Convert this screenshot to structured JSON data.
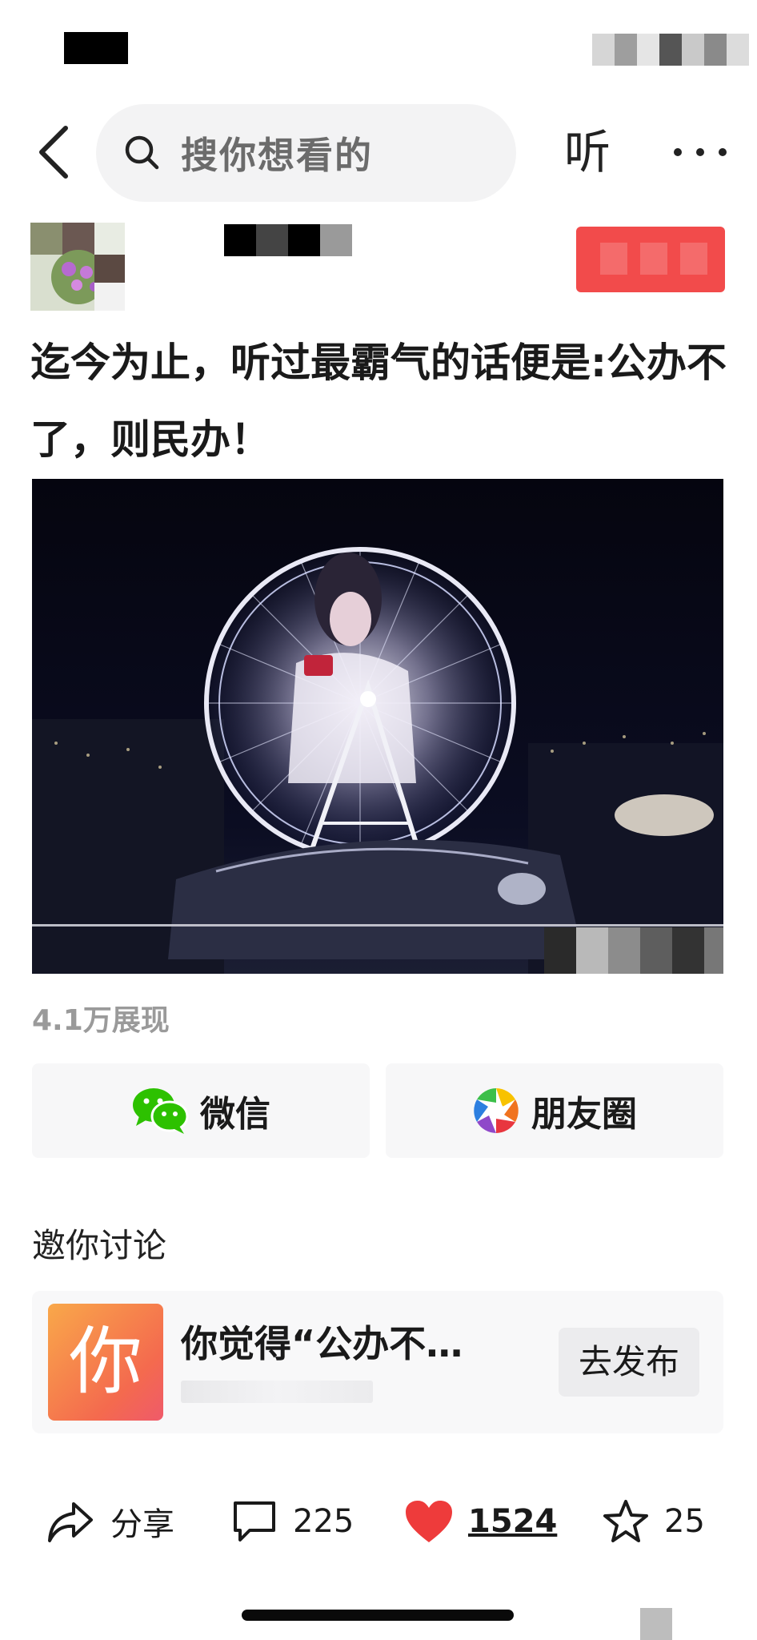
{
  "search": {
    "placeholder": "搜你想看的"
  },
  "nav": {
    "listen_label": "听"
  },
  "post": {
    "title": "迄今为止，听过最霸气的话便是:公办不了，则民办！",
    "views": "4.1万展现"
  },
  "share": {
    "wechat_label": "微信",
    "moments_label": "朋友圈"
  },
  "discussion": {
    "heading": "邀你讨论",
    "thumb_char": "你",
    "prompt": "你觉得“公办不…",
    "publish_label": "去发布"
  },
  "actions": {
    "share_label": "分享",
    "comments": "225",
    "likes": "1524",
    "favorites": "25"
  },
  "colors": {
    "follow_button": "#f24b4b",
    "like_heart": "#ee3b3b",
    "wechat_green": "#2dc100"
  }
}
